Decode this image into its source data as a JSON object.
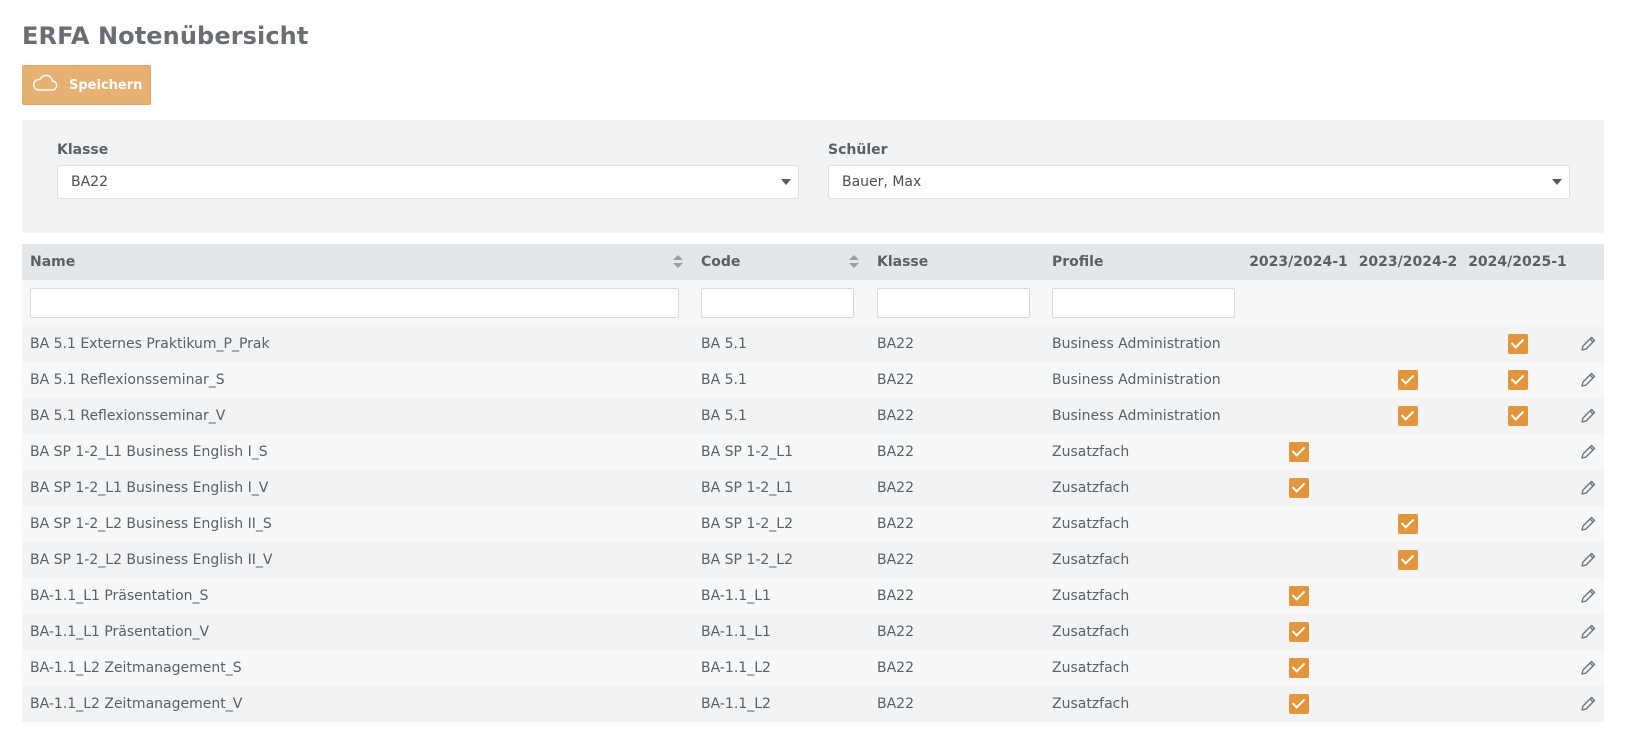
{
  "page": {
    "title": "ERFA Notenübersicht"
  },
  "toolbar": {
    "save_label": "Speichern",
    "save_icon": "cloud-icon"
  },
  "filters": {
    "klasse": {
      "label": "Klasse",
      "value": "BA22"
    },
    "schueler": {
      "label": "Schüler",
      "value": "Bauer, Max"
    }
  },
  "table": {
    "headers": {
      "name": "Name",
      "code": "Code",
      "klasse": "Klasse",
      "profile": "Profile",
      "sem1": "2023/2024-1",
      "sem2": "2023/2024-2",
      "sem3": "2024/2025-1"
    },
    "rows": [
      {
        "name": "BA 5.1 Externes Praktikum_P_Prak",
        "code": "BA 5.1",
        "klasse": "BA22",
        "profile": "Business Administration",
        "checks": [
          false,
          false,
          true
        ]
      },
      {
        "name": "BA 5.1 Reflexionsseminar_S",
        "code": "BA 5.1",
        "klasse": "BA22",
        "profile": "Business Administration",
        "checks": [
          false,
          true,
          true
        ]
      },
      {
        "name": "BA 5.1 Reflexionsseminar_V",
        "code": "BA 5.1",
        "klasse": "BA22",
        "profile": "Business Administration",
        "checks": [
          false,
          true,
          true
        ]
      },
      {
        "name": "BA SP 1-2_L1 Business English I_S",
        "code": "BA SP 1-2_L1",
        "klasse": "BA22",
        "profile": "Zusatzfach",
        "checks": [
          true,
          false,
          false
        ]
      },
      {
        "name": "BA SP 1-2_L1 Business English I_V",
        "code": "BA SP 1-2_L1",
        "klasse": "BA22",
        "profile": "Zusatzfach",
        "checks": [
          true,
          false,
          false
        ]
      },
      {
        "name": "BA SP 1-2_L2 Business English II_S",
        "code": "BA SP 1-2_L2",
        "klasse": "BA22",
        "profile": "Zusatzfach",
        "checks": [
          false,
          true,
          false
        ]
      },
      {
        "name": "BA SP 1-2_L2 Business English II_V",
        "code": "BA SP 1-2_L2",
        "klasse": "BA22",
        "profile": "Zusatzfach",
        "checks": [
          false,
          true,
          false
        ]
      },
      {
        "name": "BA-1.1_L1 Präsentation_S",
        "code": "BA-1.1_L1",
        "klasse": "BA22",
        "profile": "Zusatzfach",
        "checks": [
          true,
          false,
          false
        ]
      },
      {
        "name": "BA-1.1_L1 Präsentation_V",
        "code": "BA-1.1_L1",
        "klasse": "BA22",
        "profile": "Zusatzfach",
        "checks": [
          true,
          false,
          false
        ]
      },
      {
        "name": "BA-1.1_L2 Zeitmanagement_S",
        "code": "BA-1.1_L2",
        "klasse": "BA22",
        "profile": "Zusatzfach",
        "checks": [
          true,
          false,
          false
        ]
      },
      {
        "name": "BA-1.1_L2 Zeitmanagement_V",
        "code": "BA-1.1_L2",
        "klasse": "BA22",
        "profile": "Zusatzfach",
        "checks": [
          true,
          false,
          false
        ]
      }
    ]
  },
  "colors": {
    "accent": "#e3953b",
    "button": "#e6b172",
    "panel": "#f1f3f4",
    "header": "#e3e7ea"
  }
}
